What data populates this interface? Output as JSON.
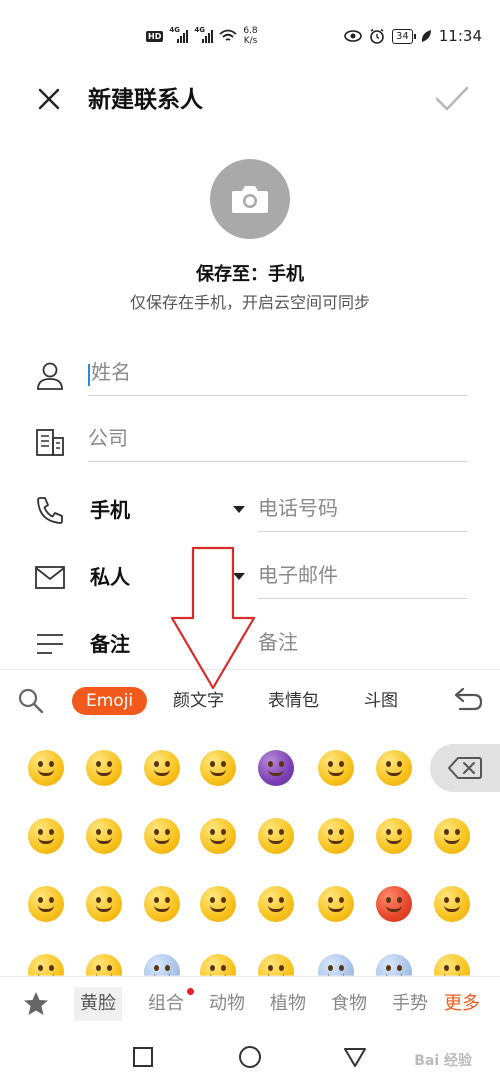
{
  "status_bar": {
    "hd_badge": "HD",
    "network_1": "4G",
    "network_2": "4G",
    "speed_value": "6.8",
    "speed_unit": "K/s",
    "battery": "34",
    "time": "11:34"
  },
  "header": {
    "title": "新建联系人"
  },
  "avatar": {
    "save_to": "保存至：手机",
    "hint": "仅保存在手机，开启云空间可同步"
  },
  "form": {
    "name_placeholder": "姓名",
    "company_placeholder": "公司",
    "phone_label": "手机",
    "phone_placeholder": "电话号码",
    "email_label": "私人",
    "email_placeholder": "电子邮件",
    "note_label": "备注",
    "note_placeholder": "备注"
  },
  "keyboard": {
    "tabs": [
      {
        "label": "Emoji",
        "active": true
      },
      {
        "label": "颜文字",
        "active": false
      },
      {
        "label": "表情包",
        "active": false
      },
      {
        "label": "斗图",
        "active": false
      }
    ],
    "categories": [
      {
        "label": "黄脸",
        "active": true
      },
      {
        "label": "组合",
        "active": false
      },
      {
        "label": "动物",
        "active": false
      },
      {
        "label": "植物",
        "active": false
      },
      {
        "label": "食物",
        "active": false
      },
      {
        "label": "手势",
        "active": false
      }
    ],
    "more_label": "更多",
    "accent_color": "#f25a1c"
  },
  "watermark": "Bai 经验"
}
